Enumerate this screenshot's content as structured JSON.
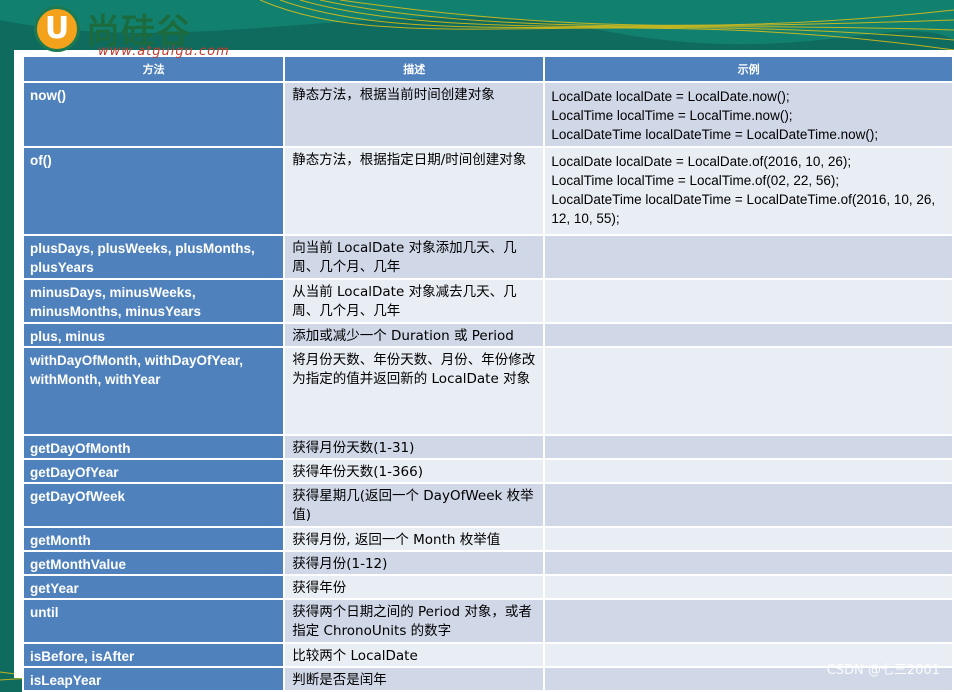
{
  "brand": {
    "logo_letter": "U",
    "logo_text": "尚硅谷",
    "logo_url": "www.atguigu.com"
  },
  "table": {
    "headers": [
      "方法",
      "描述",
      "示例"
    ],
    "rows": [
      {
        "method": "now()",
        "desc": "静态方法，根据当前时间创建对象",
        "example": [
          "LocalDate localDate = LocalDate.now();",
          "LocalTime localTime = LocalTime.now();",
          "LocalDateTime localDateTime = LocalDateTime.now();"
        ]
      },
      {
        "method": "of()",
        "desc": "静态方法，根据指定日期/时间创建对象",
        "example": [
          "LocalDate localDate = LocalDate.of(2016, 10, 26);",
          "LocalTime localTime = LocalTime.of(02, 22, 56);",
          "LocalDateTime localDateTime = LocalDateTime.of(2016, 10, 26, 12, 10, 55);"
        ]
      },
      {
        "method": "plusDays, plusWeeks, plusMonths, plusYears",
        "desc": "向当前 LocalDate 对象添加几天、几周、几个月、几年",
        "example": []
      },
      {
        "method": "minusDays, minusWeeks, minusMonths, minusYears",
        "desc": "从当前 LocalDate 对象减去几天、几周、几个月、几年",
        "example": []
      },
      {
        "method": "plus, minus",
        "desc": "添加或减少一个 Duration 或 Period",
        "example": []
      },
      {
        "method": "withDayOfMonth, withDayOfYear, withMonth, withYear",
        "desc": "将月份天数、年份天数、月份、年份修改为指定的值并返回新的 LocalDate 对象",
        "example": []
      },
      {
        "method": "getDayOfMonth",
        "desc": "获得月份天数(1-31)",
        "example": []
      },
      {
        "method": "getDayOfYear",
        "desc": "获得年份天数(1-366)",
        "example": []
      },
      {
        "method": "getDayOfWeek",
        "desc": "获得星期几(返回一个 DayOfWeek 枚举值)",
        "example": []
      },
      {
        "method": "getMonth",
        "desc": "获得月份, 返回一个 Month 枚举值",
        "example": []
      },
      {
        "method": "getMonthValue",
        "desc": "获得月份(1-12)",
        "example": []
      },
      {
        "method": "getYear",
        "desc": "获得年份",
        "example": []
      },
      {
        "method": "until",
        "desc": "获得两个日期之间的 Period 对象，或者指定 ChronoUnits 的数字",
        "example": []
      },
      {
        "method": "isBefore, isAfter",
        "desc": "比较两个 LocalDate",
        "example": []
      },
      {
        "method": "isLeapYear",
        "desc": "判断是否是闰年",
        "example": []
      }
    ]
  },
  "watermark": "CSDN @七三2001"
}
